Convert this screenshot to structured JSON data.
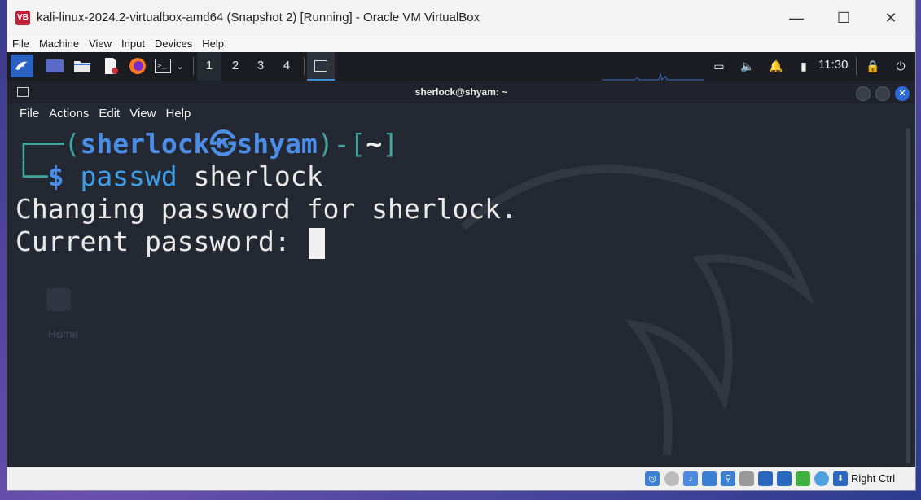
{
  "window": {
    "title": "kali-linux-2024.2-virtualbox-amd64 (Snapshot 2) [Running] - Oracle VM VirtualBox",
    "controls": {
      "minimize": "—",
      "maximize": "☐",
      "close": "✕"
    }
  },
  "vbox_menu": [
    "File",
    "Machine",
    "View",
    "Input",
    "Devices",
    "Help"
  ],
  "panel": {
    "workspaces": [
      "1",
      "2",
      "3",
      "4"
    ],
    "active_workspace": "1",
    "clock": "11:30",
    "icons": [
      "kali-menu-icon",
      "desktop-icon",
      "file-manager-icon",
      "text-editor-icon",
      "firefox-icon",
      "terminal-icon",
      "network-icon",
      "volume-icon",
      "notifications-icon",
      "battery-icon",
      "lock-icon",
      "power-icon"
    ]
  },
  "desktop": {
    "home_label": "Home"
  },
  "terminal": {
    "title": "sherlock@shyam: ~",
    "menu": [
      "File",
      "Actions",
      "Edit",
      "View",
      "Help"
    ],
    "prompt": {
      "open": "┌──(",
      "user": "sherlock",
      "at": "㉿",
      "host": "shyam",
      "mid": ")-[",
      "path": "~",
      "close": "]",
      "line2_prefix": "└─",
      "dollar": "$",
      "cmd": "passwd",
      "arg": " sherlock"
    },
    "output": [
      "Changing password for sherlock.",
      "Current password: "
    ]
  },
  "statusbar": {
    "right_ctrl": "Right Ctrl"
  },
  "colors": {
    "accent": "#3b8fe0",
    "prompt_cyan": "#3fa79b",
    "prompt_blue": "#4c8de6",
    "terminal_bg": "#242833"
  }
}
